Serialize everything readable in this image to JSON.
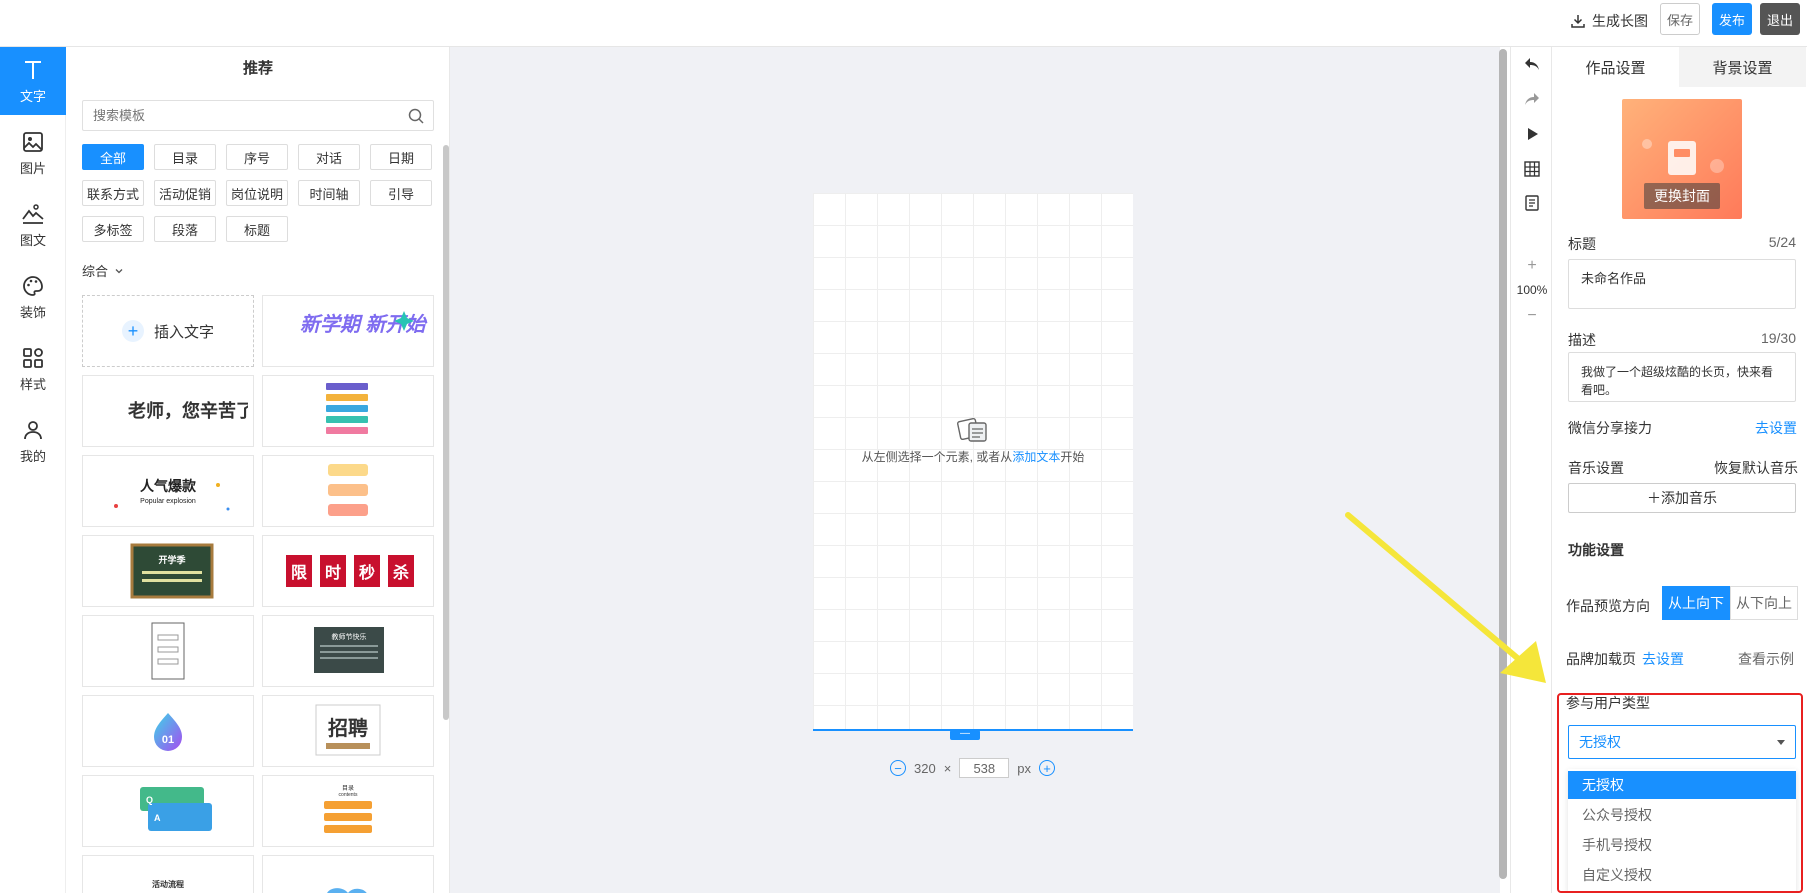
{
  "topbar": {
    "generate_long_image": "生成长图",
    "save": "保存",
    "publish": "发布",
    "exit": "退出"
  },
  "leftnav": {
    "items": [
      {
        "label": "文字",
        "icon": "text-icon"
      },
      {
        "label": "图片",
        "icon": "image-icon"
      },
      {
        "label": "图文",
        "icon": "image-text-icon"
      },
      {
        "label": "装饰",
        "icon": "palette-icon"
      },
      {
        "label": "样式",
        "icon": "style-grid-icon"
      },
      {
        "label": "我的",
        "icon": "user-icon"
      }
    ]
  },
  "panel": {
    "title": "推荐",
    "search_placeholder": "搜索模板",
    "tags": [
      "全部",
      "目录",
      "序号",
      "对话",
      "日期",
      "联系方式",
      "活动促销",
      "岗位说明",
      "时间轴",
      "引导",
      "多标签",
      "段落",
      "标题"
    ],
    "sort": "综合",
    "insert_text": "插入文字",
    "cards": [
      "新学期 新开始",
      "老师，您辛苦了",
      "人气爆款",
      "Popular explosion",
      "开学季",
      "限",
      "时",
      "秒",
      "杀",
      "教师节快乐",
      "01",
      "招聘",
      "目录",
      "contents",
      "活动流程",
      "Q",
      "A"
    ]
  },
  "canvas": {
    "hint_before": "从左侧选择一个元素, 或者从",
    "hint_link": "添加文本",
    "hint_after": "开始",
    "width": "320",
    "times": "×",
    "height": "538",
    "unit": "px",
    "handle": "—"
  },
  "tools": {
    "zoom": "100%",
    "zoom_in": "+",
    "zoom_out": "−"
  },
  "right": {
    "tab_work": "作品设置",
    "tab_bg": "背景设置",
    "change_cover": "更换封面",
    "title_label": "标题",
    "title_count": "5/24",
    "title_value": "未命名作品",
    "desc_label": "描述",
    "desc_count": "19/30",
    "desc_value": "我做了一个超级炫酷的长页，快来看看吧。",
    "wechat_label": "微信分享接力",
    "wechat_link": "去设置",
    "music_label": "音乐设置",
    "music_reset": "恢复默认音乐",
    "add_music": "＋添加音乐",
    "func_title": "功能设置",
    "preview_dir_label": "作品预览方向",
    "dir_top_down": "从上向下",
    "dir_bottom_up": "从下向上",
    "brand_label": "品牌加载页",
    "brand_link": "去设置",
    "brand_example": "查看示例",
    "user_type_label": "参与用户类型",
    "user_type_selected": "无授权",
    "user_type_options": [
      "无授权",
      "公众号授权",
      "手机号授权",
      "自定义授权"
    ]
  },
  "colors": {
    "primary": "#1890ff",
    "annotation_red": "#e82020",
    "annotation_yellow": "#f5e63a"
  }
}
